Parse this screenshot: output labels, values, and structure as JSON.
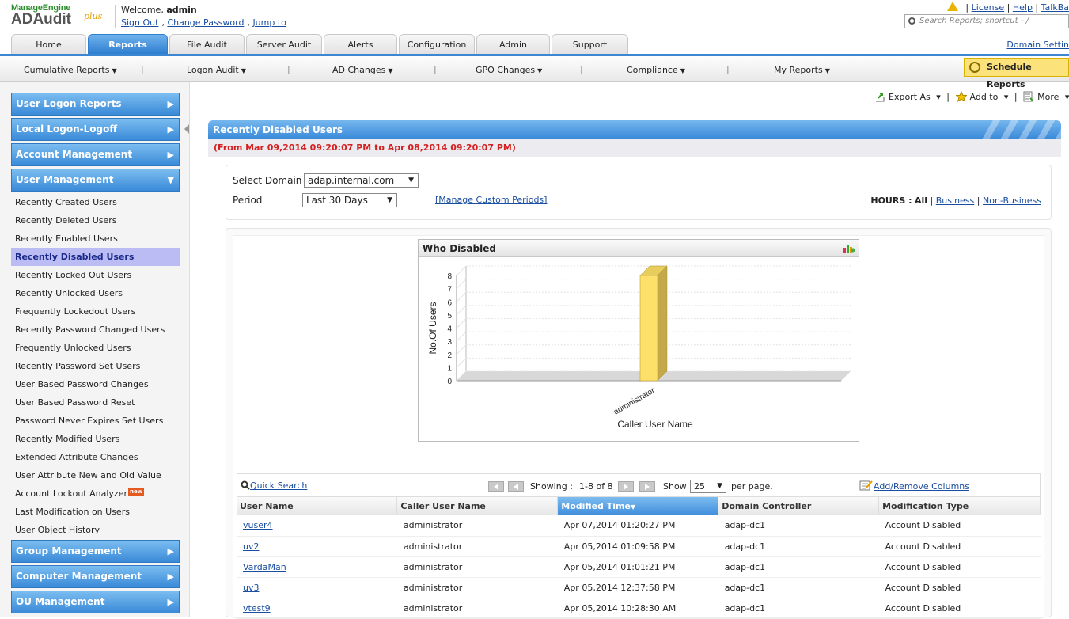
{
  "header": {
    "brand_top": "ManageEngine",
    "brand_main": "ADAudit",
    "brand_plus": "plus",
    "welcome_prefix": "Welcome,",
    "username": "admin",
    "links": [
      "Sign Out",
      "Change Password",
      "Jump to"
    ],
    "top_links": [
      "License",
      "Help",
      "TalkBa"
    ],
    "search_placeholder": "Search Reports; shortcut - /",
    "domain_settings": "Domain Settin"
  },
  "tabs": [
    "Home",
    "Reports",
    "File Audit",
    "Server Audit",
    "Alerts",
    "Configuration",
    "Admin",
    "Support"
  ],
  "active_tab": "Reports",
  "subnav": [
    "Cumulative Reports",
    "Logon Audit",
    "AD Changes",
    "GPO Changes",
    "Compliance",
    "My Reports"
  ],
  "schedule_button": "Schedule Reports",
  "sidebar": {
    "categories_top": [
      "User Logon Reports",
      "Local Logon-Logoff",
      "Account Management",
      "User Management"
    ],
    "items": [
      "Recently Created Users",
      "Recently Deleted Users",
      "Recently Enabled Users",
      "Recently Disabled Users",
      "Recently Locked Out Users",
      "Recently Unlocked Users",
      "Frequently Lockedout Users",
      "Recently Password Changed Users",
      "Frequently Unlocked Users",
      "Recently Password Set Users",
      "User Based Password Changes",
      "User Based Password Reset",
      "Password Never Expires Set Users",
      "Recently Modified Users",
      "Extended Attribute Changes",
      "User Attribute New and Old Value",
      "Account Lockout Analyzer",
      "Last Modification on Users",
      "User Object History"
    ],
    "selected_item": "Recently Disabled Users",
    "new_badge": "new",
    "categories_bottom": [
      "Group Management",
      "Computer Management",
      "OU Management"
    ]
  },
  "actions": {
    "export": "Export As",
    "add_to": "Add to",
    "more": "More"
  },
  "report": {
    "title": "Recently Disabled Users",
    "date_range": "(From Mar 09,2014 09:20:07 PM to Apr 08,2014 09:20:07 PM)",
    "select_domain_label": "Select Domain",
    "domain_value": "adap.internal.com",
    "period_label": "Period",
    "period_value": "Last 30 Days",
    "manage_custom": "[Manage Custom Periods]",
    "hours_label": "HOURS :",
    "hours_all": "All",
    "hours_business": "Business",
    "hours_nonbusiness": "Non-Business"
  },
  "chart_data": {
    "type": "bar",
    "title": "Who Disabled",
    "categories": [
      "administrator"
    ],
    "values": [
      8
    ],
    "xlabel": "Caller User Name",
    "ylabel": "No.Of Users",
    "ylim": [
      0,
      8
    ],
    "yticks": [
      "0",
      "1",
      "2",
      "3",
      "4",
      "5",
      "6",
      "7",
      "8"
    ],
    "bar_color": "#fde06a"
  },
  "pager": {
    "quick_search": "Quick Search",
    "showing_label": "Showing :",
    "showing_value": "1-8 of 8",
    "show_label": "Show",
    "per_page_value": "25",
    "per_page_label": "per page.",
    "add_remove": "Add/Remove Columns"
  },
  "table": {
    "columns": [
      "User Name",
      "Caller User Name",
      "Modified Time",
      "Domain Controller",
      "Modification Type"
    ],
    "sorted_column": "Modified Time",
    "rows": [
      [
        "vuser4",
        "administrator",
        "Apr 07,2014 01:20:27 PM",
        "adap-dc1",
        "Account Disabled"
      ],
      [
        "uv2",
        "administrator",
        "Apr 05,2014 01:09:58 PM",
        "adap-dc1",
        "Account Disabled"
      ],
      [
        "VardaMan",
        "administrator",
        "Apr 05,2014 01:01:21 PM",
        "adap-dc1",
        "Account Disabled"
      ],
      [
        "uv3",
        "administrator",
        "Apr 05,2014 12:37:58 PM",
        "adap-dc1",
        "Account Disabled"
      ],
      [
        "vtest9",
        "administrator",
        "Apr 05,2014 10:28:30 AM",
        "adap-dc1",
        "Account Disabled"
      ]
    ]
  }
}
